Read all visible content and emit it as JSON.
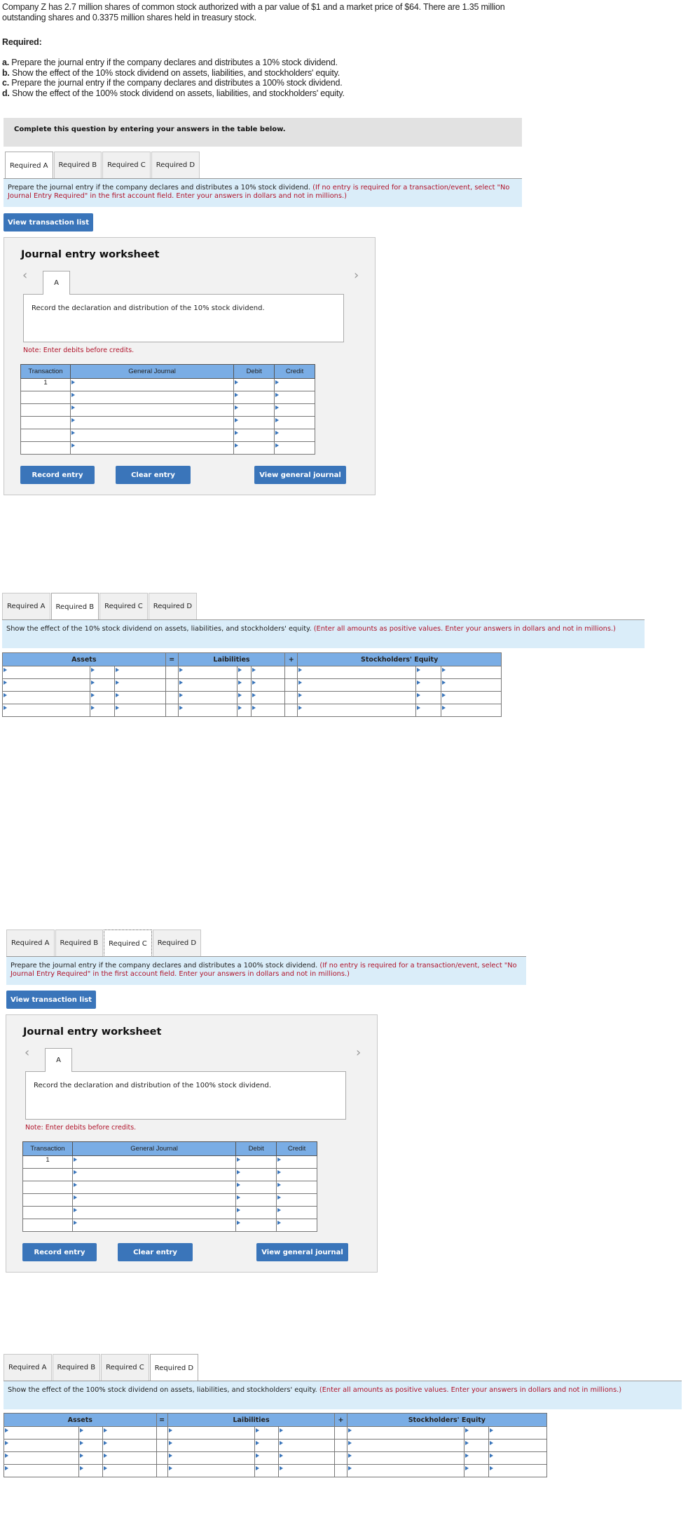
{
  "problem": {
    "line1": "Company Z has 2.7 million shares of common stock authorized with a par value of $1 and a market price of $64. There are 1.35 million outstanding shares and 0.3375 million shares held in treasury stock.",
    "required_heading": "Required:",
    "items": [
      {
        "letter": "a.",
        "text": " Prepare the journal entry if the company declares and distributes a 10% stock dividend."
      },
      {
        "letter": "b.",
        "text": " Show the effect of the 10% stock dividend on assets, liabilities, and stockholders' equity."
      },
      {
        "letter": "c.",
        "text": " Prepare the journal entry if the company declares and distributes a 100% stock dividend."
      },
      {
        "letter": "d.",
        "text": " Show the effect of the 100% stock dividend on assets, liabilities, and stockholders' equity."
      }
    ]
  },
  "complete_bar": "Complete this question by entering your answers in the table below.",
  "tabs": [
    "Required A",
    "Required B",
    "Required C",
    "Required D"
  ],
  "sections": {
    "a": {
      "active_tab": "Required A",
      "instruction": "Prepare the journal entry if the company declares and distributes a 10% stock dividend.",
      "instruction_note": "(If no entry is required for a transaction/event, select \"No Journal Entry Required\" in the first account field. Enter your answers in dollars and not in millions.)",
      "view_transaction_list": "View transaction list",
      "worksheet": {
        "title": "Journal entry worksheet",
        "tab": "A",
        "description": "Record the declaration and distribution of the 10% stock dividend.",
        "note": "Note: Enter debits before credits.",
        "columns": [
          "Transaction",
          "General Journal",
          "Debit",
          "Credit"
        ],
        "rows": [
          {
            "transaction": "1",
            "account": "",
            "debit": "",
            "credit": ""
          },
          {
            "transaction": "",
            "account": "",
            "debit": "",
            "credit": ""
          },
          {
            "transaction": "",
            "account": "",
            "debit": "",
            "credit": ""
          },
          {
            "transaction": "",
            "account": "",
            "debit": "",
            "credit": ""
          },
          {
            "transaction": "",
            "account": "",
            "debit": "",
            "credit": ""
          },
          {
            "transaction": "",
            "account": "",
            "debit": "",
            "credit": ""
          }
        ],
        "record_entry": "Record entry",
        "clear_entry": "Clear entry",
        "view_general_journal": "View general journal"
      }
    },
    "b": {
      "active_tab": "Required B",
      "instruction": "Show the effect of the 10% stock dividend on assets, liabilities, and stockholders' equity.",
      "instruction_note": "(Enter all amounts as positive values. Enter your answers in dollars and not in millions.)",
      "headers": {
        "assets": "Assets",
        "equals": "=",
        "liabilities": "Laibilities",
        "plus": "+",
        "equity": "Stockholders' Equity"
      },
      "row_count": 4
    },
    "c": {
      "active_tab": "Required C",
      "instruction": "Prepare the journal entry if the company declares and distributes a 100% stock dividend.",
      "instruction_note": "(If no entry is required for a transaction/event, select \"No Journal Entry Required\" in the first account field. Enter your answers in dollars and not in millions.)",
      "view_transaction_list": "View transaction list",
      "worksheet": {
        "title": "Journal entry worksheet",
        "tab": "A",
        "description": "Record the declaration and distribution of the 100% stock dividend.",
        "note": "Note: Enter debits before credits.",
        "columns": [
          "Transaction",
          "General Journal",
          "Debit",
          "Credit"
        ],
        "rows": [
          {
            "transaction": "1",
            "account": "",
            "debit": "",
            "credit": ""
          },
          {
            "transaction": "",
            "account": "",
            "debit": "",
            "credit": ""
          },
          {
            "transaction": "",
            "account": "",
            "debit": "",
            "credit": ""
          },
          {
            "transaction": "",
            "account": "",
            "debit": "",
            "credit": ""
          },
          {
            "transaction": "",
            "account": "",
            "debit": "",
            "credit": ""
          },
          {
            "transaction": "",
            "account": "",
            "debit": "",
            "credit": ""
          }
        ],
        "record_entry": "Record entry",
        "clear_entry": "Clear entry",
        "view_general_journal": "View general journal"
      }
    },
    "d": {
      "active_tab": "Required D",
      "instruction": "Show the effect of the 100% stock dividend on assets, liabilities, and stockholders' equity.",
      "instruction_note": "(Enter all amounts as positive values. Enter your answers in dollars and not in millions.)",
      "headers": {
        "assets": "Assets",
        "equals": "=",
        "liabilities": "Laibilities",
        "plus": "+",
        "equity": "Stockholders' Equity"
      },
      "row_count": 4
    }
  },
  "icons": {
    "prev": "‹",
    "next": "›"
  },
  "colors": {
    "accent": "#3a75ba",
    "header_blue": "#7aade5",
    "instruction_bg": "#daedf9",
    "note_red": "#b0132a"
  }
}
